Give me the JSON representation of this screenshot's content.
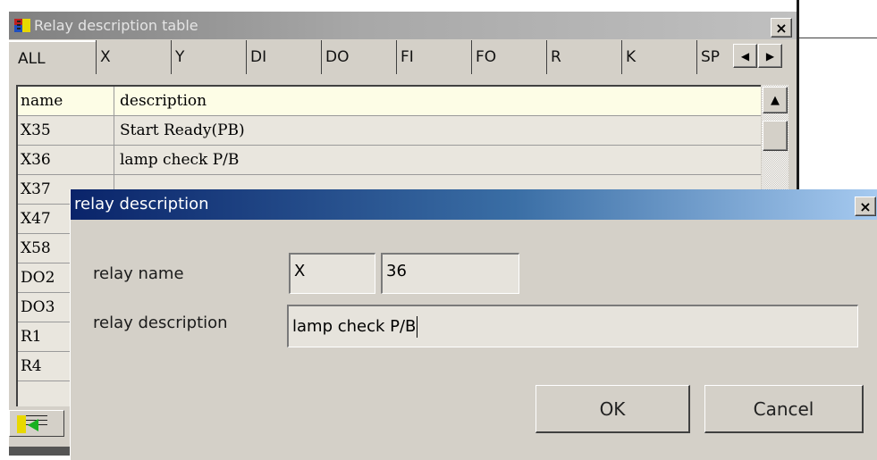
{
  "background_window": {
    "title": "Relay description table",
    "close_label": "×",
    "tabs": [
      {
        "label": "ALL",
        "active": true
      },
      {
        "label": "X"
      },
      {
        "label": "Y"
      },
      {
        "label": "DI"
      },
      {
        "label": "DO"
      },
      {
        "label": "FI"
      },
      {
        "label": "FO"
      },
      {
        "label": "R"
      },
      {
        "label": "K"
      },
      {
        "label": "SP"
      }
    ],
    "tab_scroll_left": "◀",
    "tab_scroll_right": "▶",
    "table": {
      "columns": [
        "name",
        "description"
      ],
      "rows": [
        {
          "name": "X35",
          "description": "Start Ready(PB)"
        },
        {
          "name": "X36",
          "description": "lamp check P/B"
        },
        {
          "name": "X37",
          "description": ""
        },
        {
          "name": "X47",
          "description": ""
        },
        {
          "name": "X58",
          "description": ""
        },
        {
          "name": "DO2",
          "description": ""
        },
        {
          "name": "DO3",
          "description": ""
        },
        {
          "name": "R1",
          "description": ""
        },
        {
          "name": "R4",
          "description": ""
        }
      ]
    },
    "scroll_up": "▲"
  },
  "dialog": {
    "title": "relay description",
    "close_label": "×",
    "relay_name_label": "relay name",
    "relay_type_value": "X",
    "relay_number_value": "36",
    "relay_description_label": "relay description",
    "relay_description_value": "lamp check P/B",
    "ok_label": "OK",
    "cancel_label": "Cancel"
  },
  "colors": {
    "dialog_title_start": "#0a246a",
    "dialog_title_end": "#a6caf0",
    "window_face": "#d4d0c8",
    "table_header_bg": "#fdfde6"
  }
}
